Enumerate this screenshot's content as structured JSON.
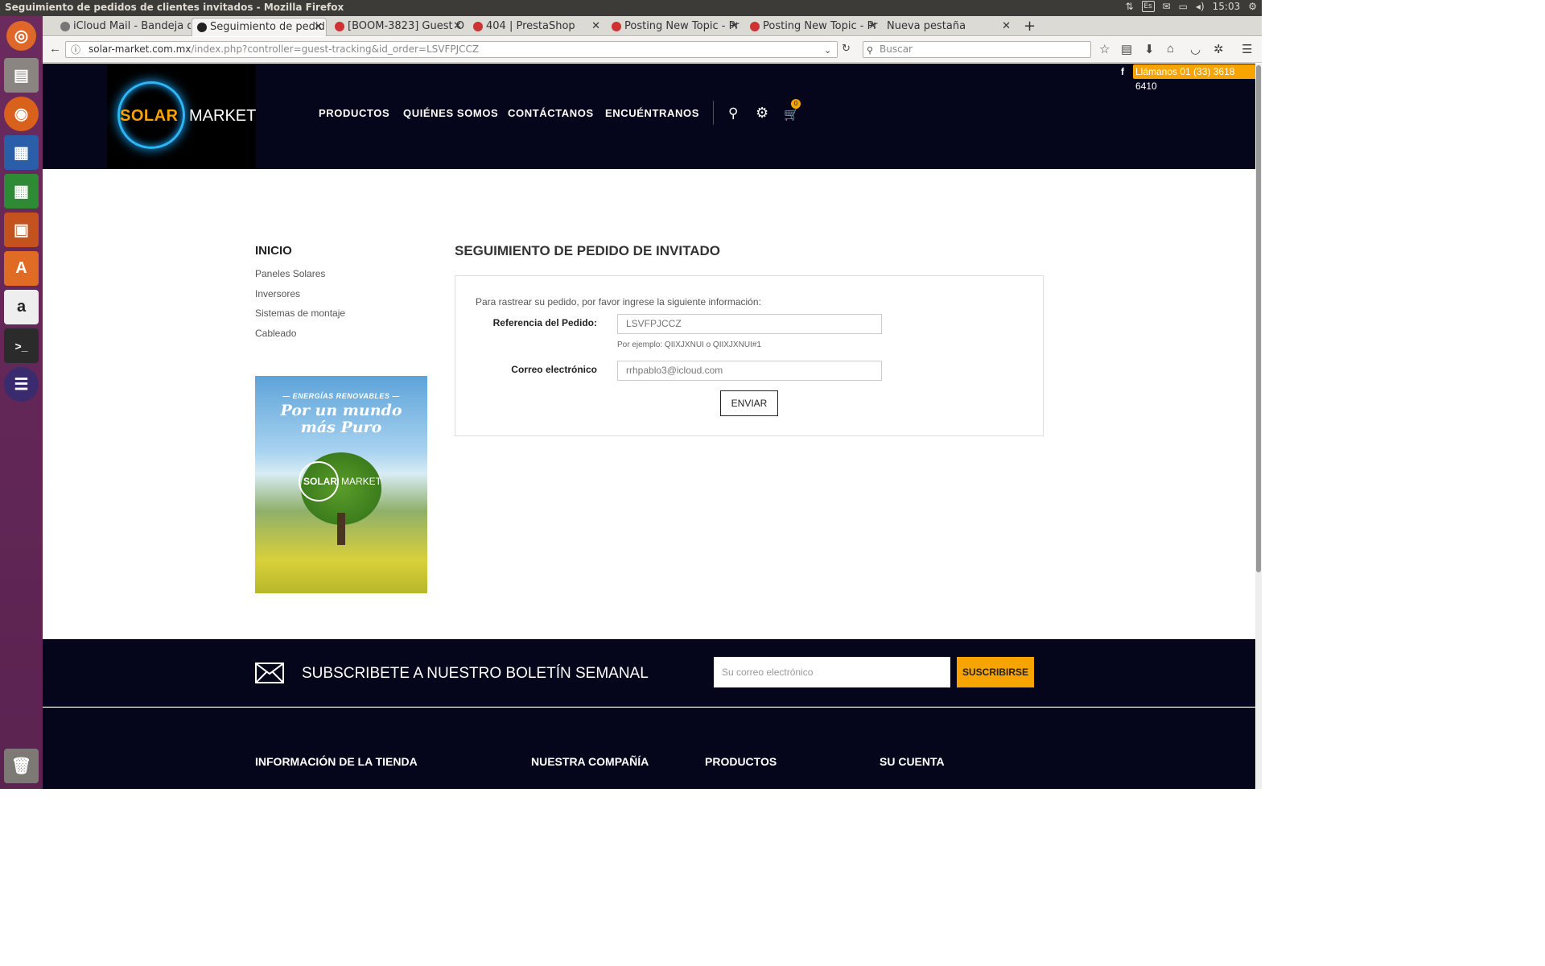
{
  "system": {
    "window_title": "Seguimiento de pedidos de clientes invitados - Mozilla Firefox",
    "language": "Es",
    "clock": "15:03"
  },
  "tabs": [
    {
      "label": "iCloud Mail - Bandeja d"
    },
    {
      "label": "Seguimiento de pedid"
    },
    {
      "label": "[BOOM-3823] Guest O"
    },
    {
      "label": "404 | PrestaShop"
    },
    {
      "label": "Posting New Topic - Pr"
    },
    {
      "label": "Posting New Topic - Pr"
    },
    {
      "label": "Nueva pestaña"
    }
  ],
  "browser": {
    "url_domain": "solar-market.com.mx",
    "url_path": "/index.php?controller=guest-tracking&id_order=LSVFPJCCZ",
    "search_placeholder": "Buscar"
  },
  "site": {
    "logo_solar": "SOLAR",
    "logo_market": "MARKET",
    "menu": [
      "PRODUCTOS",
      "QUIÉNES SOMOS",
      "CONTÁCTANOS",
      "ENCUÉNTRANOS"
    ],
    "cart_count": "0",
    "facebook": "f",
    "phone_label": "Llámanos 01 (33) 3618 6410"
  },
  "sidebar": {
    "title": "INICIO",
    "links": [
      "Paneles Solares",
      "Inversores",
      "Sistemas de montaje",
      "Cableado"
    ],
    "banner": {
      "subtitle": "— ENERGÍAS RENOVABLES —",
      "title_line1": "Por un mundo",
      "title_line2": "más Puro",
      "logo_solar": "SOLAR",
      "logo_market": "MARKET"
    }
  },
  "main": {
    "title": "SEGUIMIENTO DE PEDIDO DE INVITADO",
    "intro": "Para rastrear su pedido, por favor ingrese la siguiente información:",
    "order_label": "Referencia del Pedido:",
    "order_value": "LSVFPJCCZ",
    "order_hint": "Por ejemplo: QIIXJXNUI o QIIXJXNUI#1",
    "email_label": "Correo electrónico",
    "email_value": "rrhpablo3@icloud.com",
    "submit": "ENVIAR"
  },
  "newsletter": {
    "title": "SUBSCRIBETE A NUESTRO BOLETÍN SEMANAL",
    "placeholder": "Su correo electrónico",
    "button": "SUSCRIBIRSE"
  },
  "footer": {
    "headings": [
      "INFORMACIÓN DE LA TIENDA",
      "NUESTRA COMPAÑÍA",
      "PRODUCTOS",
      "SU CUENTA"
    ]
  },
  "colors": {
    "brand_dark": "#05061c",
    "accent_orange": "#f7a400",
    "launcher": "#6b2b5e"
  }
}
